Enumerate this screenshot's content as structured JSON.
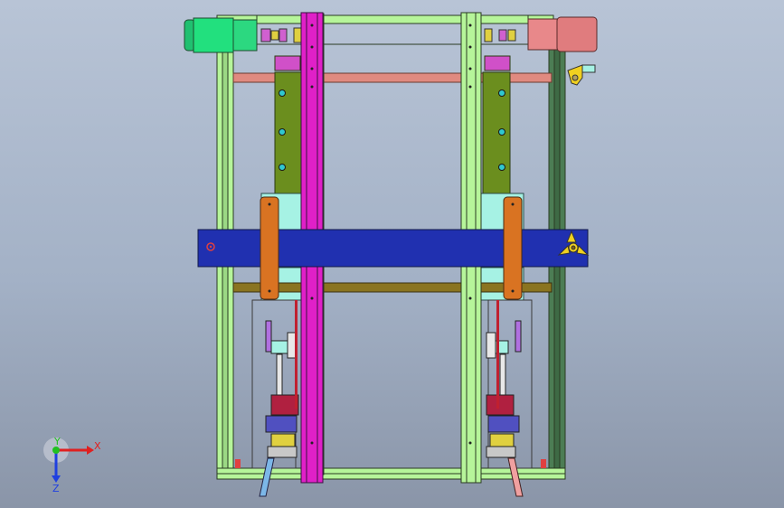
{
  "triad": {
    "x_label": "X",
    "y_label": "Y",
    "z_label": "Z"
  }
}
